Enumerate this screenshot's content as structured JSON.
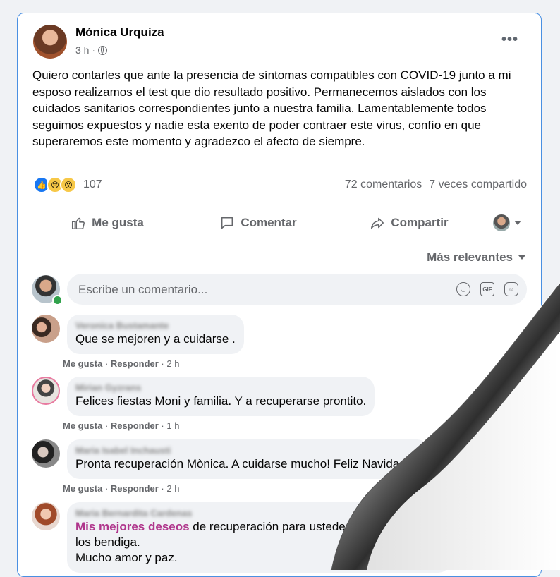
{
  "post": {
    "author": "Mónica Urquiza",
    "time": "3 h ·",
    "more_label": "•••",
    "text": "Quiero contarles que ante la presencia de síntomas compatibles con COVID-19 junto a mi esposo realizamos el test que dio resultado positivo. Permanecemos aislados con los cuidados sanitarios correspondientes junto a nuestra familia. Lamentablemente todos seguimos expuestos y nadie esta exento de poder contraer este virus, confío en que superaremos este momento y agradezco el afecto de siempre.",
    "reactions_count": "107",
    "comments_count": "72 comentarios",
    "shares_count": "7 veces compartido"
  },
  "actions": {
    "like": "Me gusta",
    "comment": "Comentar",
    "share": "Compartir"
  },
  "sort_label": "Más relevantes",
  "comment_input": {
    "placeholder": "Escribe un comentario..."
  },
  "comments": [
    {
      "name": "Veronica Bustamante",
      "text": "Que se mejoren y a cuidarse .",
      "like": "Me gusta",
      "reply": "Responder",
      "time": "2 h"
    },
    {
      "name": "Mirian Gyzrans",
      "text": "Felices fiestas Moni y familia. Y a recuperarse prontito.",
      "like": "Me gusta",
      "reply": "Responder",
      "time": "1 h"
    },
    {
      "name": "Maria Isabel Inchausti",
      "text": "Pronta recuperación Mònica. A cuidarse mucho! Feliz Navidad",
      "like": "Me gusta",
      "reply": "Responder",
      "time": "2 h"
    },
    {
      "name": "Maria Bernardita Cardenas",
      "highlight": "Mis mejores deseos",
      "text_rest": " de recuperación para ustedes y que el niño",
      "line2": "los bendiga.",
      "line3": "Mucho amor y paz."
    }
  ],
  "colors": {
    "accent": "#1877f2",
    "highlight": "#b0368c",
    "border": "#4a90e2"
  }
}
